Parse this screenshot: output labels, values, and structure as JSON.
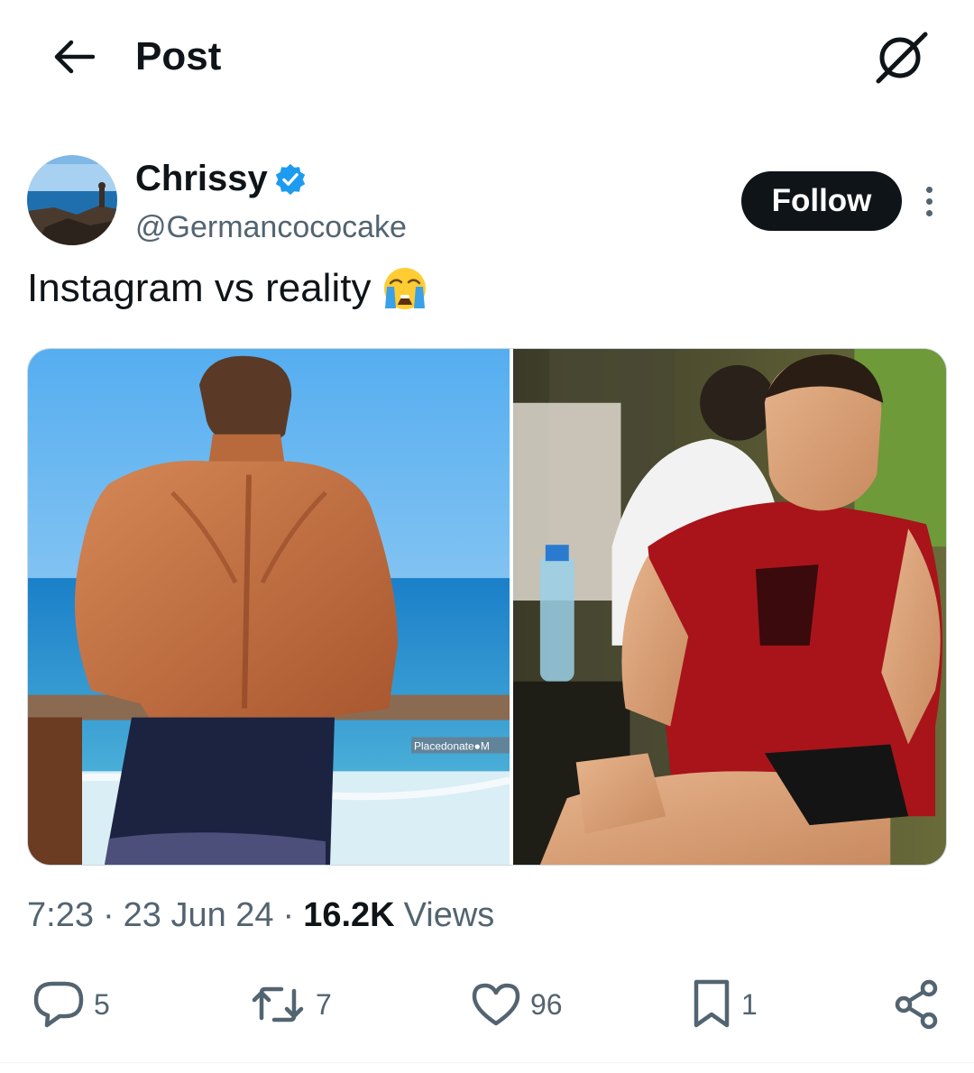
{
  "header": {
    "title": "Post",
    "back_icon": "arrow-left-icon",
    "grok_icon": "grok-icon"
  },
  "author": {
    "display_name": "Chrissy",
    "handle": "@Germancococake",
    "verified": true,
    "avatar_icon": "avatar-beach-photo"
  },
  "follow_label": "Follow",
  "tweet": {
    "text": "Instagram vs reality",
    "emoji": "loudly-crying-face-icon",
    "media_watermark": "Placedonate●M"
  },
  "meta": {
    "time": "7:23",
    "date": "23 Jun 24",
    "views_count": "16.2K",
    "views_label": "Views"
  },
  "actions": {
    "replies": "5",
    "reposts": "7",
    "likes": "96",
    "bookmarks": "1"
  },
  "colors": {
    "text_primary": "#0f1419",
    "text_secondary": "#536471",
    "verified_blue": "#1d9bf0",
    "follow_bg": "#0f1419"
  }
}
